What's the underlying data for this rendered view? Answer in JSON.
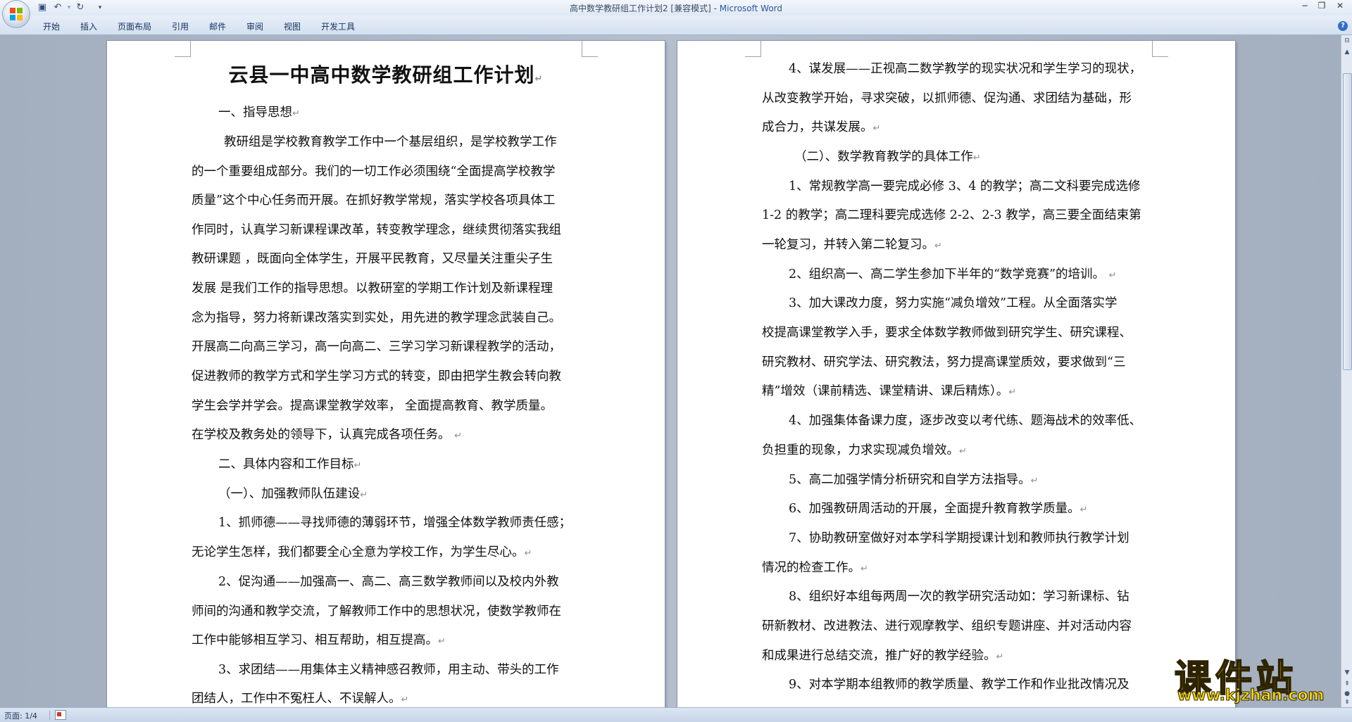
{
  "window": {
    "doc_name": "高中数学教研组工作计划2 [兼容模式]",
    "separator": " - ",
    "app_name": "Microsoft Word"
  },
  "quick_access": {
    "save_icon": "save-icon",
    "undo_icon": "undo-icon",
    "redo_icon": "redo-icon",
    "customize_icon": "chevron-down-icon"
  },
  "ribbon": {
    "tabs": [
      "开始",
      "插入",
      "页面布局",
      "引用",
      "邮件",
      "审阅",
      "视图",
      "开发工具"
    ]
  },
  "pilcrow": "↵",
  "left_page": {
    "title": "云县一中高中数学教研组工作计划",
    "lines": [
      "一、指导思想",
      "教研组是学校教育教学工作中一个基层组织，是学校教学工作",
      "的一个重要组成部分。我们的一切工作必须围绕“全面提高学校教学",
      "质量”这个中心任务而开展。在抓好教学常规，落实学校各项具体工",
      "作同时，认真学习新课程课改革，转变教学理念，继续贯彻落实我组",
      "教研课题 ，既面向全体学生，开展平民教育，又尽量关注重尖子生",
      "发展  是我们工作的指导思想。以教研室的学期工作计划及新课程理",
      "念为指导，努力将新课改落实到实处，用先进的教学理念武装自己。",
      "开展高二向高三学习，高一向高二、三学习学习新课程教学的活动，",
      "促进教师的教学方式和学生学习方式的转变，即由把学生教会转向教",
      "学生会学并学会。提高课堂教学效率，  全面提高教育、教学质量。",
      "在学校及教务处的领导下，认真完成各项任务。",
      "二、具体内容和工作目标",
      "（一）、加强教师队伍建设",
      "1、抓师德——寻找师德的薄弱环节，增强全体数学教师责任感；",
      "无论学生怎样，我们都要全心全意为学校工作，为学生尽心。",
      "2、促沟通——加强高一、高二、高三数学教师间以及校内外教",
      "师间的沟通和教学交流，了解教师工作中的思想状况，使数学教师在",
      "工作中能够相互学习、相互帮助，相互提高。",
      "3、求团结——用集体主义精神感召教师，用主动、带头的工作",
      "团结人，工作中不冤枉人、不误解人。"
    ]
  },
  "right_page": {
    "lines": [
      "4、谋发展——正视高二数学教学的现实状况和学生学习的现状，",
      "从改变教学开始，寻求突破，以抓师德、促沟通、求团结为基础，形",
      "成合力，共谋发展。",
      "（二）、数学教育教学的具体工作",
      "1、常规教学高一要完成必修 3、4 的教学；高二文科要完成选修",
      "1-2 的教学；高二理科要完成选修 2-2、2-3 教学，高三要全面结束第",
      "一轮复习，并转入第二轮复习。",
      "2、组织高一、高二学生参加下半年的“数学竞赛”的培训。",
      "3、加大课改力度，努力实施“减负增效”工程。从全面落实学",
      "校提高课堂教学入手，要求全体数学教师做到研究学生、研究课程、",
      "研究教材、研究学法、研究教法，努力提高课堂质效，要求做到“三",
      "精”增效（课前精选、课堂精讲、课后精炼）。",
      "4、加强集体备课力度，逐步改变以考代练、题海战术的效率低、",
      "负担重的现象，力求实现减负增效。",
      "5、高二加强学情分析研究和自学方法指导。",
      "6、加强教研周活动的开展，全面提升教育教学质量。",
      "7、协助教研室做好对本学科学期授课计划和教师执行教学计划",
      "情况的检查工作。",
      "8、组织好本组每两周一次的教学研究活动如：学习新课标、钻",
      "研新教材、改进教法、进行观摩教学、组织专题讲座、并对活动内容",
      "和成果进行总结交流，推广好的教学经验。",
      "9、对本学期本组教师的教学质量、教学工作和作业批改情况及"
    ]
  },
  "status_bar": {
    "page_info": "页面: 1/4"
  },
  "watermark": {
    "text": "课件站",
    "url": "www.kjzhan.com"
  },
  "colors": {
    "ribbon": "#d4e0f0",
    "doc_background": "#a9b4c4",
    "watermark_yellow": "#f7d700"
  }
}
